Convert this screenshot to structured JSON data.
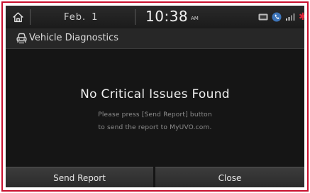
{
  "status_bar": {
    "date_month": "Feb.",
    "date_day": "1",
    "time": "10:38",
    "ampm": "AM",
    "icons": [
      "home-icon",
      "sd-card-icon",
      "phone-icon",
      "signal-icon",
      "bluetooth-icon"
    ]
  },
  "title_bar": {
    "title": "Vehicle Diagnostics",
    "icon": "car-diagnostics-icon"
  },
  "main": {
    "headline": "No Critical Issues Found",
    "message_line1": "Please press [Send Report] button",
    "message_line2": "to send the report to MyUVO.com."
  },
  "buttons": {
    "send_report": "Send Report",
    "close": "Close"
  },
  "colors": {
    "frame_border": "#c8102e",
    "bluetooth": "#e0283c",
    "background": "#151515"
  }
}
